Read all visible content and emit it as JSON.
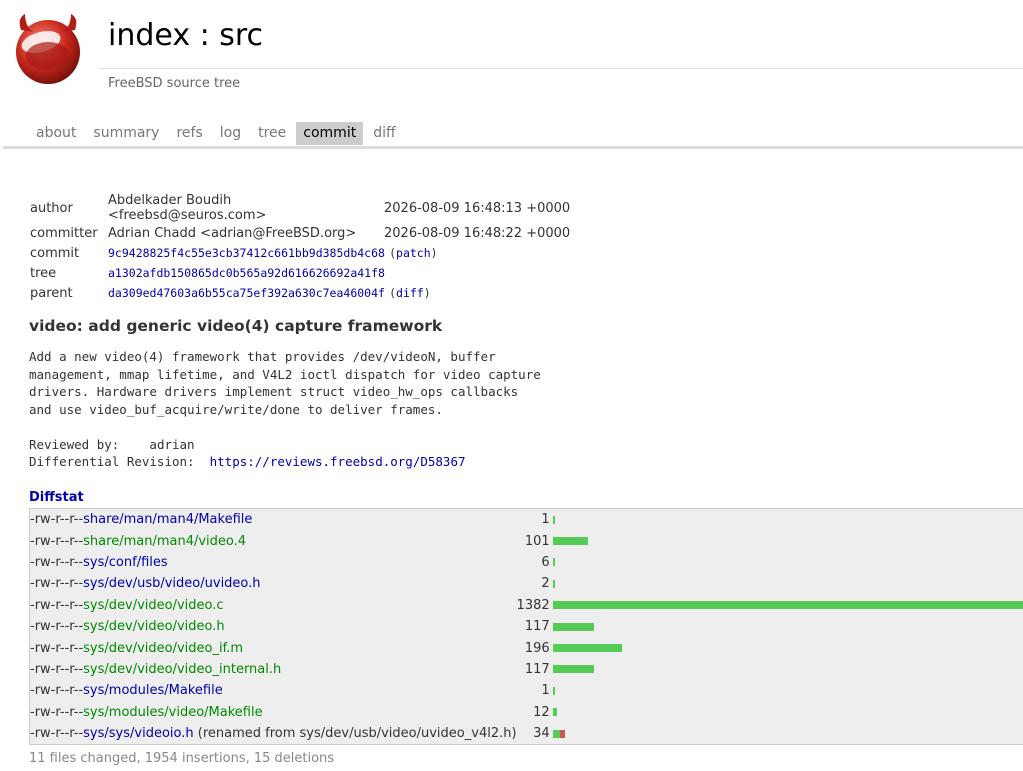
{
  "header": {
    "title": "index : src",
    "description": "FreeBSD source tree"
  },
  "tabs": [
    "about",
    "summary",
    "refs",
    "log",
    "tree",
    "commit",
    "diff"
  ],
  "active_tab": "commit",
  "commit_info": {
    "author_label": "author",
    "author": "Abdelkader Boudih <freebsd@seuros.com>",
    "author_date": "2026-08-09 16:48:13 +0000",
    "committer_label": "committer",
    "committer": "Adrian Chadd <adrian@FreeBSD.org>",
    "committer_date": "2026-08-09 16:48:22 +0000",
    "commit_label": "commit",
    "commit": "9c9428825f4c55e3cb37412c661bb9d385db4c68",
    "patch_label": "patch",
    "tree_label": "tree",
    "tree": "a1302afdb150865dc0b565a92d616626692a41f8",
    "parent_label": "parent",
    "parent": "da309ed47603a6b55ca75ef392a630c7ea46004f",
    "diff_label": "diff"
  },
  "subject": "video: add generic video(4) capture framework",
  "message": {
    "body": "Add a new video(4) framework that provides /dev/videoN, buffer\nmanagement, mmap lifetime, and V4L2 ioctl dispatch for video capture\ndrivers. Hardware drivers implement struct video_hw_ops callbacks\nand use video_buf_acquire/write/done to deliver frames.\n\nReviewed by:\tadrian\nDifferential Revision:\t",
    "revision_link": "https://reviews.freebsd.org/D58367"
  },
  "diffstat": {
    "heading": "Diffstat",
    "rows": [
      {
        "mode": "-rw-r--r--",
        "path": "share/man/man4/Makefile",
        "color": "blue",
        "rename": "",
        "count": "1",
        "ins": 1,
        "del": 0
      },
      {
        "mode": "-rw-r--r--",
        "path": "share/man/man4/video.4",
        "color": "green",
        "rename": "",
        "count": "101",
        "ins": 101,
        "del": 0
      },
      {
        "mode": "-rw-r--r--",
        "path": "sys/conf/files",
        "color": "blue",
        "rename": "",
        "count": "6",
        "ins": 6,
        "del": 0
      },
      {
        "mode": "-rw-r--r--",
        "path": "sys/dev/usb/video/uvideo.h",
        "color": "blue",
        "rename": "",
        "count": "2",
        "ins": 2,
        "del": 0
      },
      {
        "mode": "-rw-r--r--",
        "path": "sys/dev/video/video.c",
        "color": "green",
        "rename": "",
        "count": "1382",
        "ins": 1382,
        "del": 0
      },
      {
        "mode": "-rw-r--r--",
        "path": "sys/dev/video/video.h",
        "color": "green",
        "rename": "",
        "count": "117",
        "ins": 117,
        "del": 0
      },
      {
        "mode": "-rw-r--r--",
        "path": "sys/dev/video/video_if.m",
        "color": "green",
        "rename": "",
        "count": "196",
        "ins": 196,
        "del": 0
      },
      {
        "mode": "-rw-r--r--",
        "path": "sys/dev/video/video_internal.h",
        "color": "green",
        "rename": "",
        "count": "117",
        "ins": 117,
        "del": 0
      },
      {
        "mode": "-rw-r--r--",
        "path": "sys/modules/Makefile",
        "color": "blue",
        "rename": "",
        "count": "1",
        "ins": 1,
        "del": 0
      },
      {
        "mode": "-rw-r--r--",
        "path": "sys/modules/video/Makefile",
        "color": "green",
        "rename": "",
        "count": "12",
        "ins": 12,
        "del": 0
      },
      {
        "mode": "-rw-r--r--",
        "path": "sys/sys/videoio.h",
        "color": "blue",
        "rename": " (renamed from sys/dev/usb/video/uvideo_v4l2.h)",
        "count": "34",
        "ins": 19,
        "del": 15
      }
    ],
    "max": 1382,
    "summary": "11 files changed, 1954 insertions, 15 deletions"
  }
}
